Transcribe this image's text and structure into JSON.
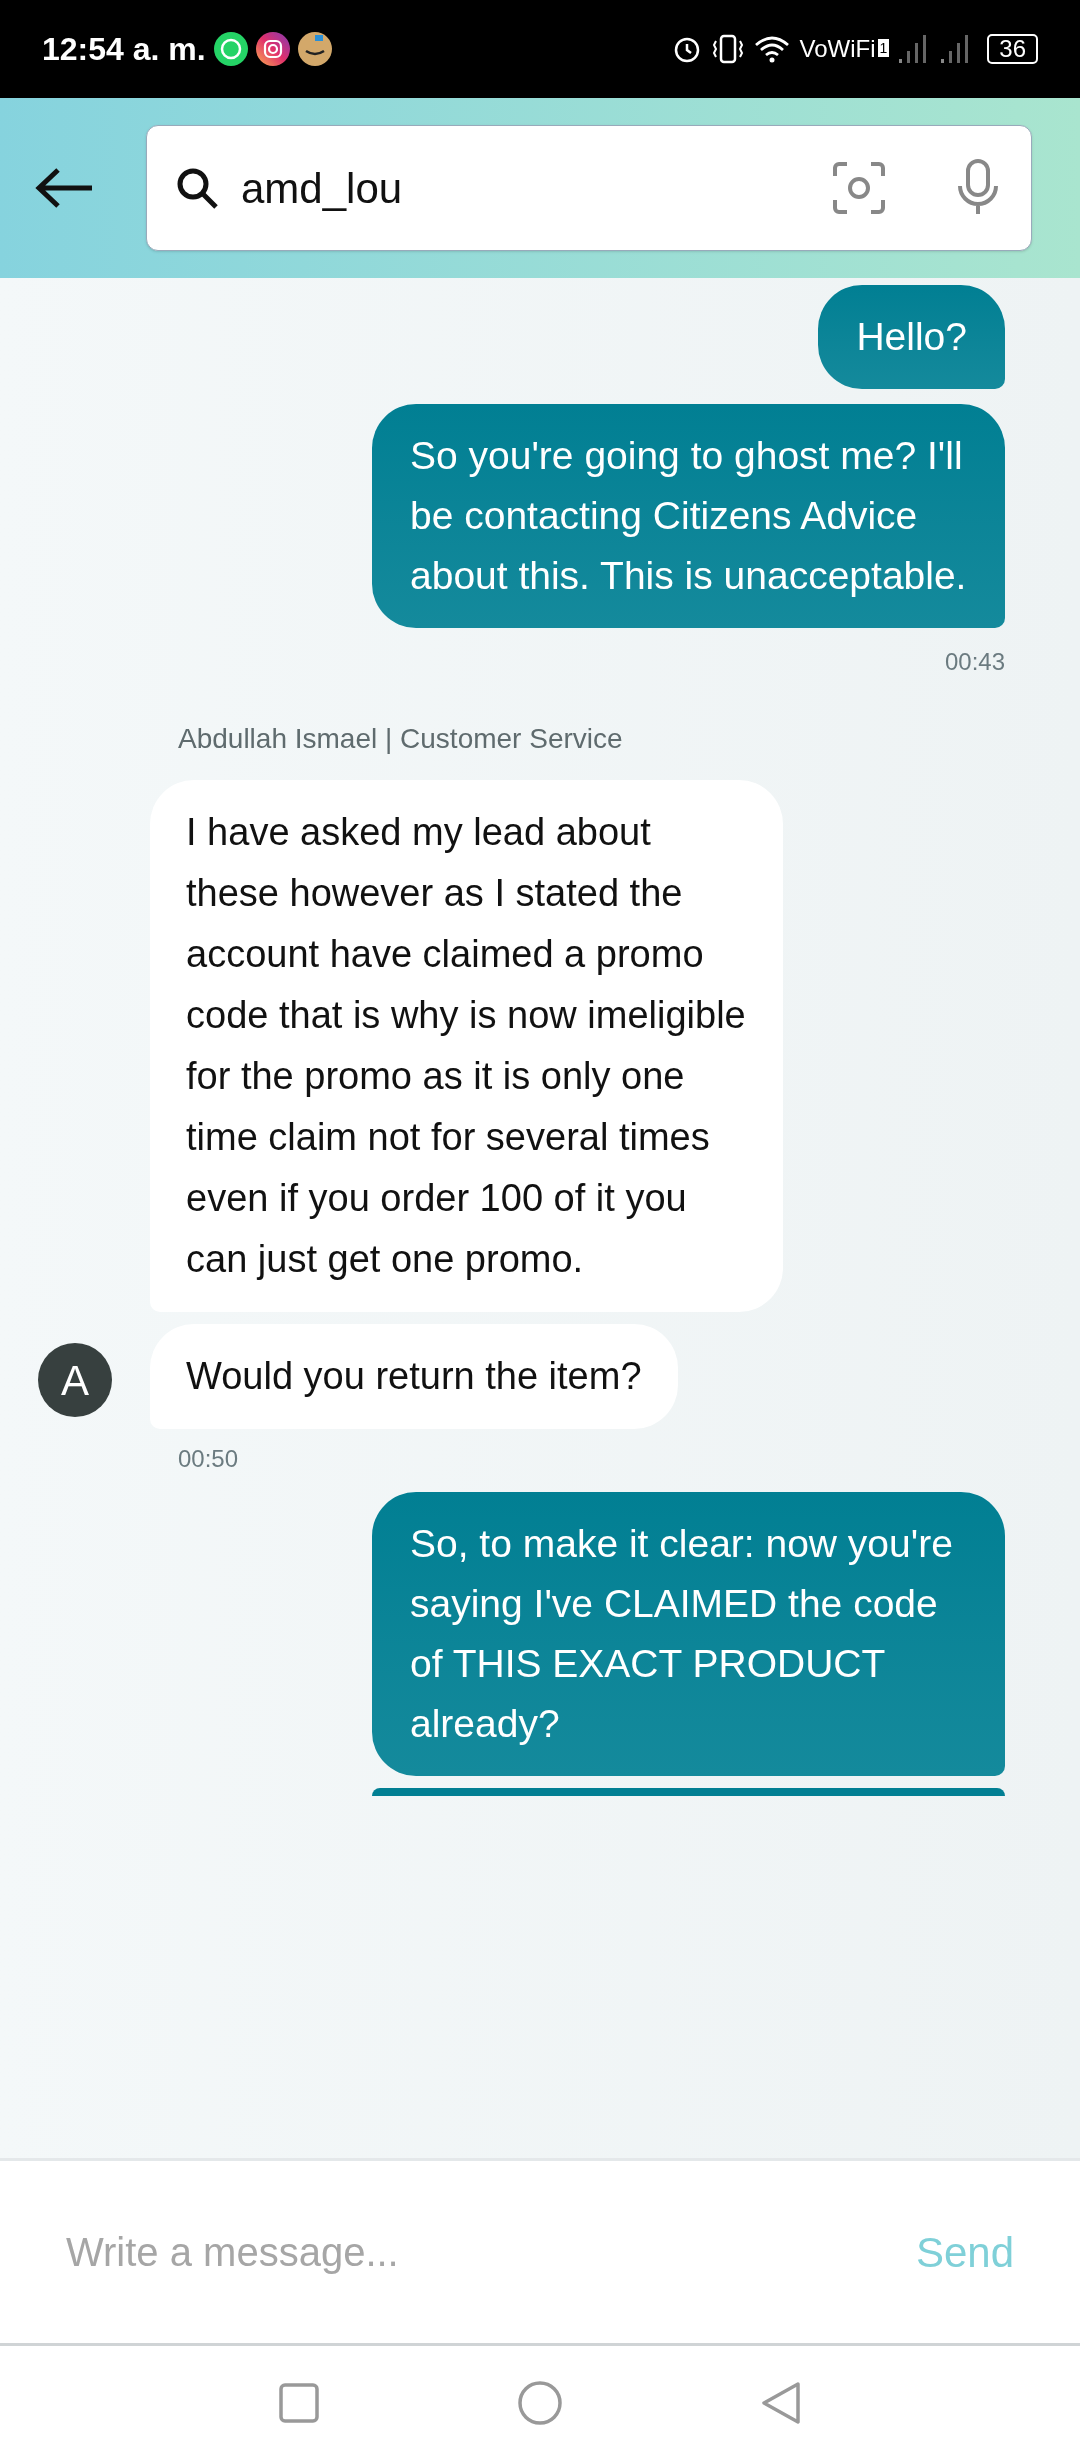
{
  "status_bar": {
    "time": "12:54 a. m.",
    "network_label": "VoWiFi",
    "sim_badge": "1",
    "battery": "36"
  },
  "search": {
    "value": "amd_lou"
  },
  "messages": [
    {
      "kind": "sent",
      "text": "Hello?"
    },
    {
      "kind": "sent",
      "text": "So you're going to ghost me? I'll be contacting Citizens Advice about this. This is unacceptable."
    },
    {
      "kind": "time_sent",
      "text": "00:43"
    },
    {
      "kind": "sender",
      "text": "Abdullah Ismael | Customer Service"
    },
    {
      "kind": "received",
      "text": "I have asked my lead about these however as I stated the account have claimed a promo code that is why is now imeligible for the promo as it is only one time claim not for several times even if you order 100 of it you can just get one promo."
    },
    {
      "kind": "received_avatar",
      "text": "Would you return the item?",
      "avatar": "A"
    },
    {
      "kind": "time_received",
      "text": "00:50"
    },
    {
      "kind": "sent",
      "text": "So, to make it clear: now you're saying I've CLAIMED the code of THIS EXACT PRODUCT already?"
    },
    {
      "kind": "sent_cut"
    }
  ],
  "composer": {
    "placeholder": "Write a message...",
    "send": "Send"
  }
}
